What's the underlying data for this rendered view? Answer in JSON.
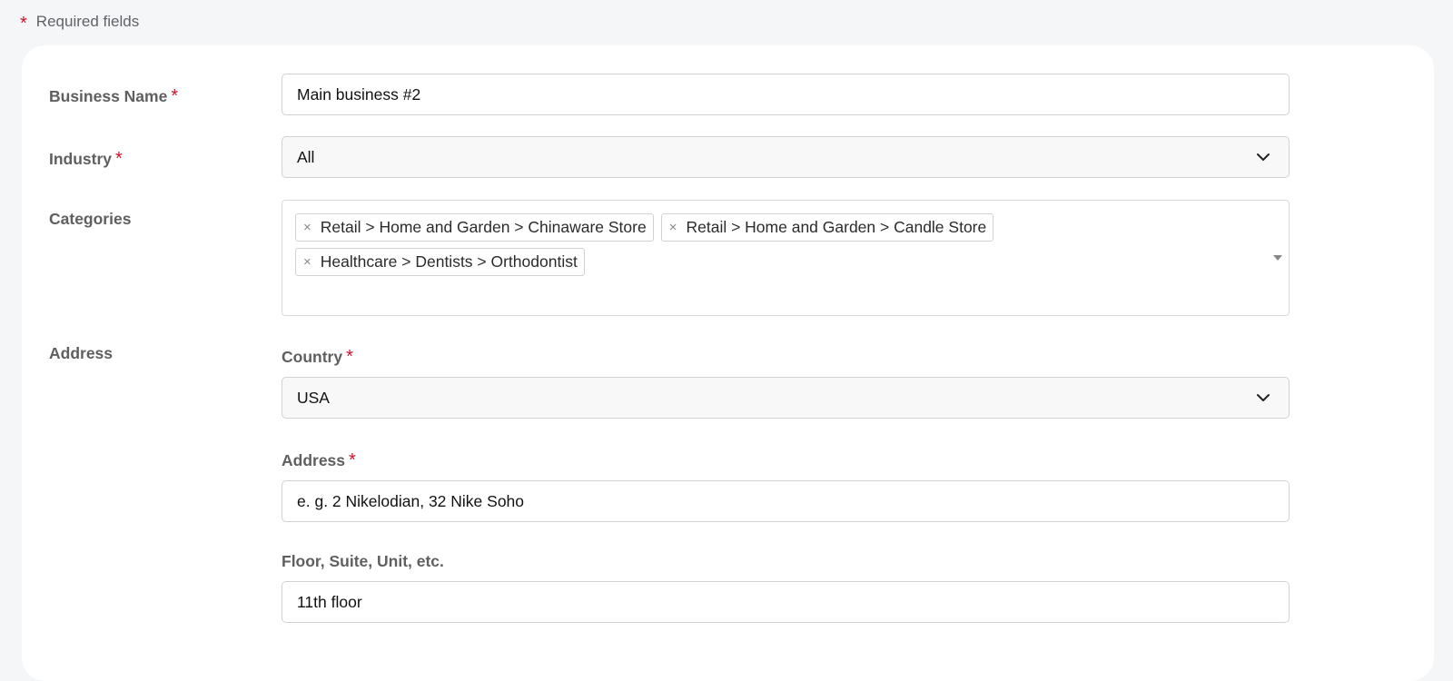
{
  "required_note": {
    "star": "*",
    "text": "Required fields"
  },
  "form": {
    "business_name": {
      "label": "Business Name",
      "required_star": "*",
      "value": "Main business #2"
    },
    "industry": {
      "label": "Industry",
      "required_star": "*",
      "value": "All"
    },
    "categories": {
      "label": "Categories",
      "remove_glyph": "×",
      "tags": [
        "Retail > Home and Garden > Chinaware Store",
        "Retail > Home and Garden > Candle Store",
        "Healthcare > Dentists > Orthodontist"
      ]
    },
    "address_section": {
      "label": "Address",
      "country": {
        "label": "Country",
        "required_star": "*",
        "value": "USA"
      },
      "address": {
        "label": "Address",
        "required_star": "*",
        "value": "e. g. 2 Nikelodian, 32 Nike Soho"
      },
      "floor": {
        "label": "Floor, Suite, Unit, etc.",
        "value": "11th floor"
      }
    }
  },
  "colors": {
    "required_star": "#d0112b",
    "label": "#5f5f5f",
    "border": "#cfd2d6"
  },
  "icons": {
    "select_arrow": "chevron-down-icon",
    "multi_caret": "caret-down-icon",
    "tag_remove": "close-icon"
  }
}
